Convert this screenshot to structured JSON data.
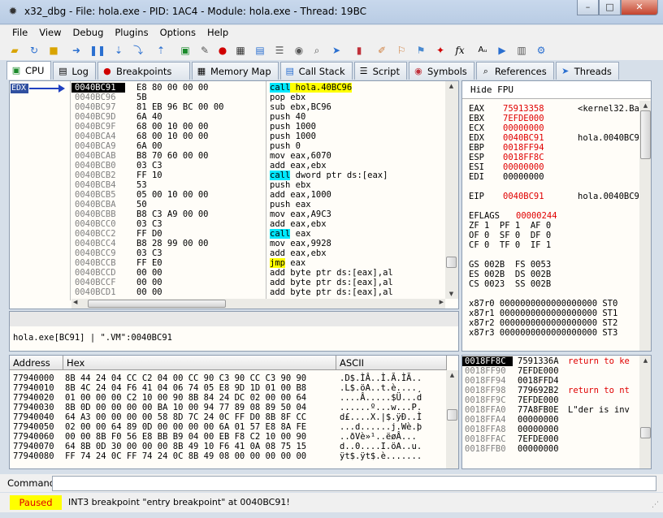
{
  "window": {
    "title": "x32_dbg - File: hola.exe - PID: 1AC4 - Module: hola.exe - Thread: 19BC",
    "minimize": "–",
    "maximize": "□",
    "close": "✕"
  },
  "menu": [
    "File",
    "View",
    "Debug",
    "Plugins",
    "Options",
    "Help"
  ],
  "toolbar_icons": [
    "open-icon",
    "restart-icon",
    "close-file-icon",
    "run-icon",
    "pause-icon",
    "step-into-icon",
    "step-over-icon",
    "execute-till-return-icon",
    "cpu-icon",
    "notes-icon",
    "breakpoint-icon",
    "memory-map-icon",
    "call-stack-icon",
    "script-icon",
    "symbols-icon",
    "references-icon",
    "threads-icon",
    "patches-icon",
    "comments-icon",
    "labels-icon",
    "bookmarks-icon",
    "functions-icon",
    "fx-icon",
    "font-icon",
    "help-icon",
    "calculator-icon",
    "settings-icon"
  ],
  "tabs": [
    {
      "label": "CPU",
      "icon": "cpu-icon"
    },
    {
      "label": "Log",
      "icon": "log-icon"
    },
    {
      "label": "Breakpoints",
      "icon": "breakpoint-icon"
    },
    {
      "label": "Memory Map",
      "icon": "memory-map-icon"
    },
    {
      "label": "Call Stack",
      "icon": "call-stack-icon"
    },
    {
      "label": "Script",
      "icon": "script-icon"
    },
    {
      "label": "Symbols",
      "icon": "symbols-icon"
    },
    {
      "label": "References",
      "icon": "references-icon"
    },
    {
      "label": "Threads",
      "icon": "threads-icon"
    }
  ],
  "disasm": {
    "edx_label": "EDX",
    "rows": [
      {
        "addr": "0040BC91",
        "bytes": "E8 80 00 00 00",
        "instr": "call hola.40BC96",
        "hl": "cyan",
        "cur": true
      },
      {
        "addr": "0040BC96",
        "bytes": "5B",
        "instr": "pop ebx"
      },
      {
        "addr": "0040BC97",
        "bytes": "81 EB 96 BC 00 00",
        "instr": "sub ebx,BC96"
      },
      {
        "addr": "0040BC9D",
        "bytes": "6A 40",
        "instr": "push 40"
      },
      {
        "addr": "0040BC9F",
        "bytes": "68 00 10 00 00",
        "instr": "push 1000"
      },
      {
        "addr": "0040BCA4",
        "bytes": "68 00 10 00 00",
        "instr": "push 1000"
      },
      {
        "addr": "0040BCA9",
        "bytes": "6A 00",
        "instr": "push 0"
      },
      {
        "addr": "0040BCAB",
        "bytes": "B8 70 60 00 00",
        "instr": "mov eax,6070"
      },
      {
        "addr": "0040BCB0",
        "bytes": "03 C3",
        "instr": "add eax,ebx"
      },
      {
        "addr": "0040BCB2",
        "bytes": "FF 10",
        "instr": "call dword ptr ds:[eax]",
        "hl": "cyan"
      },
      {
        "addr": "0040BCB4",
        "bytes": "53",
        "instr": "push ebx"
      },
      {
        "addr": "0040BCB5",
        "bytes": "05 00 10 00 00",
        "instr": "add eax,1000"
      },
      {
        "addr": "0040BCBA",
        "bytes": "50",
        "instr": "push eax"
      },
      {
        "addr": "0040BCBB",
        "bytes": "B8 C3 A9 00 00",
        "instr": "mov eax,A9C3"
      },
      {
        "addr": "0040BCC0",
        "bytes": "03 C3",
        "instr": "add eax,ebx"
      },
      {
        "addr": "0040BCC2",
        "bytes": "FF D0",
        "instr": "call eax",
        "hl": "cyan"
      },
      {
        "addr": "0040BCC4",
        "bytes": "B8 28 99 00 00",
        "instr": "mov eax,9928"
      },
      {
        "addr": "0040BCC9",
        "bytes": "03 C3",
        "instr": "add eax,ebx"
      },
      {
        "addr": "0040BCCB",
        "bytes": "FF E0",
        "instr": "jmp eax",
        "hl": "yellow"
      },
      {
        "addr": "0040BCCD",
        "bytes": "00 00",
        "instr": "add byte ptr ds:[eax],al"
      },
      {
        "addr": "0040BCCF",
        "bytes": "00 00",
        "instr": "add byte ptr ds:[eax],al"
      },
      {
        "addr": "0040BCD1",
        "bytes": "00 00",
        "instr": "add byte ptr ds:[eax],al"
      }
    ]
  },
  "info_line": "hola.exe[BC91] | \".VM\":0040BC91",
  "registers": {
    "header": "Hide FPU",
    "gp": [
      {
        "name": "EAX",
        "value": "75913358",
        "comment": "<kernel32.Ba",
        "changed": true
      },
      {
        "name": "EBX",
        "value": "7EFDE000",
        "comment": "",
        "changed": true
      },
      {
        "name": "ECX",
        "value": "00000000",
        "comment": "",
        "changed": true
      },
      {
        "name": "EDX",
        "value": "0040BC91",
        "comment": "hola.0040BC9",
        "changed": true
      },
      {
        "name": "EBP",
        "value": "0018FF94",
        "comment": "",
        "changed": true
      },
      {
        "name": "ESP",
        "value": "0018FF8C",
        "comment": "",
        "changed": true
      },
      {
        "name": "ESI",
        "value": "00000000",
        "comment": "",
        "changed": true
      },
      {
        "name": "EDI",
        "value": "00000000",
        "comment": "",
        "changed": false
      }
    ],
    "eip": {
      "name": "EIP",
      "value": "0040BC91",
      "comment": "hola.0040BC9"
    },
    "eflags": {
      "name": "EFLAGS",
      "value": "00000244"
    },
    "flags": [
      "ZF 1  PF 1  AF 0",
      "OF 0  SF 0  DF 0",
      "CF 0  TF 0  IF 1"
    ],
    "segs": [
      "GS 002B  FS 0053",
      "ES 002B  DS 002B",
      "CS 0023  SS 002B"
    ],
    "fpu": [
      "x87r0 0000000000000000000 ST0",
      "x87r1 0000000000000000000 ST1",
      "x87r2 0000000000000000000 ST2",
      "x87r3 0000000000000000000 ST3"
    ]
  },
  "dump": {
    "col_address": "Address",
    "col_hex": "Hex",
    "col_ascii": "ASCII",
    "rows": [
      {
        "addr": "77940000",
        "hex": "8B 44 24 04 CC C2 04 00 CC 90 C3 90 CC C3 90 90",
        "ascii": ".D$.ÌÂ..Ì.Ã.ÌÃ.."
      },
      {
        "addr": "77940010",
        "hex": "8B 4C 24 04 F6 41 04 06 74 05 E8 9D 1D 01 00 B8",
        "ascii": ".L$.öA..t.è....¸"
      },
      {
        "addr": "77940020",
        "hex": "01 00 00 00 C2 10 00 90 8B 84 24 DC 02 00 00 64",
        "ascii": "....Â.....$Ü...d"
      },
      {
        "addr": "77940030",
        "hex": "8B 0D 00 00 00 00 BA 10 00 94 77 89 08 89 50 04",
        "ascii": "......º...w...P."
      },
      {
        "addr": "77940040",
        "hex": "64 A3 00 00 00 00 58 8D 7C 24 0C FF D0 8B 8F CC",
        "ascii": "d£....X.|$.ÿÐ..Ì"
      },
      {
        "addr": "77940050",
        "hex": "02 00 00 64 89 0D 00 00 00 00 6A 01 57 E8 8A FE",
        "ascii": "...d......j.Wè.þ"
      },
      {
        "addr": "77940060",
        "hex": "00 00 8B F0 56 E8 BB B9 04 00 EB F8 C2 10 00 90",
        "ascii": "..ðVè»¹..ëøÂ..."
      },
      {
        "addr": "77940070",
        "hex": "64 8B 0D 30 00 00 00 8B 49 10 F6 41 0A 08 75 15",
        "ascii": "d..0....I.öA..u."
      },
      {
        "addr": "77940080",
        "hex": "FF 74 24 0C FF 74 24 0C 8B 49 08 00 00 00 00 00",
        "ascii": "ÿt$.ÿt$.è......."
      }
    ]
  },
  "stack": {
    "rows": [
      {
        "addr": "0018FF8C",
        "value": "7591336A",
        "comment": "return to ke",
        "cur": true
      },
      {
        "addr": "0018FF90",
        "value": "7EFDE000",
        "comment": ""
      },
      {
        "addr": "0018FF94",
        "value": "0018FFD4",
        "comment": ""
      },
      {
        "addr": "0018FF98",
        "value": "779692B2",
        "comment": "return to nt"
      },
      {
        "addr": "0018FF9C",
        "value": "7EFDE000",
        "comment": ""
      },
      {
        "addr": "0018FFA0",
        "value": "77A8FB0E",
        "comment": "L\"der is inv"
      },
      {
        "addr": "0018FFA4",
        "value": "00000000",
        "comment": ""
      },
      {
        "addr": "0018FFA8",
        "value": "00000000",
        "comment": ""
      },
      {
        "addr": "0018FFAC",
        "value": "7EFDE000",
        "comment": ""
      },
      {
        "addr": "0018FFB0",
        "value": "00000000",
        "comment": ""
      }
    ]
  },
  "command": {
    "label": "Command:",
    "value": ""
  },
  "status": {
    "state": "Paused",
    "message": "INT3 breakpoint \"entry breakpoint\" at 0040BC91!"
  }
}
